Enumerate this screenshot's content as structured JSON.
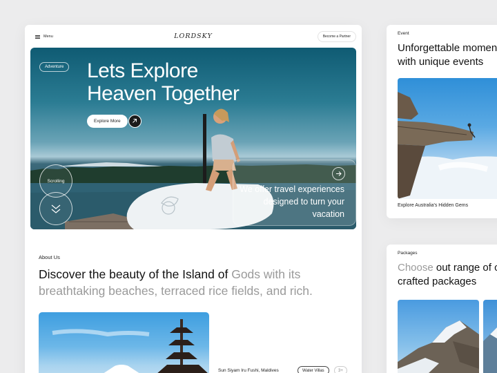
{
  "header": {
    "menu_label": "Menu",
    "logo_text": "LORDSKY",
    "partner_label": "Become a Partner"
  },
  "hero": {
    "tag": "Adventure",
    "title_line1": "Lets Explore",
    "title_line2": "Heaven Together",
    "cta_label": "Explore More",
    "scroll_label": "Scrolling",
    "offer_text": "We offer travel experiences designed to turn your vacation"
  },
  "about": {
    "label": "About Us",
    "heading_dark": "Discover the beauty of the Island of ",
    "heading_muted": "Gods with its breathtaking beaches, terraced rice fields, and rich.",
    "villa_name": "Sun Siyam Iru Fushi, Maldives",
    "villa_tag": "Water Villas",
    "villa_count": "3+"
  },
  "event": {
    "label": "Event",
    "title_line1": "Unforgettable moments",
    "title_line2": "with unique events",
    "caption": "Explore Australia's Hidden Gems"
  },
  "packages": {
    "label": "Packages",
    "title_muted": "Choose ",
    "title_dark": "out range of carefully",
    "title_line2": "crafted packages"
  },
  "colors": {
    "background": "#ececed",
    "card": "#ffffff",
    "hero_ocean": "#2b7c93",
    "text_dark": "#111111",
    "text_muted": "#9a9a9a"
  }
}
